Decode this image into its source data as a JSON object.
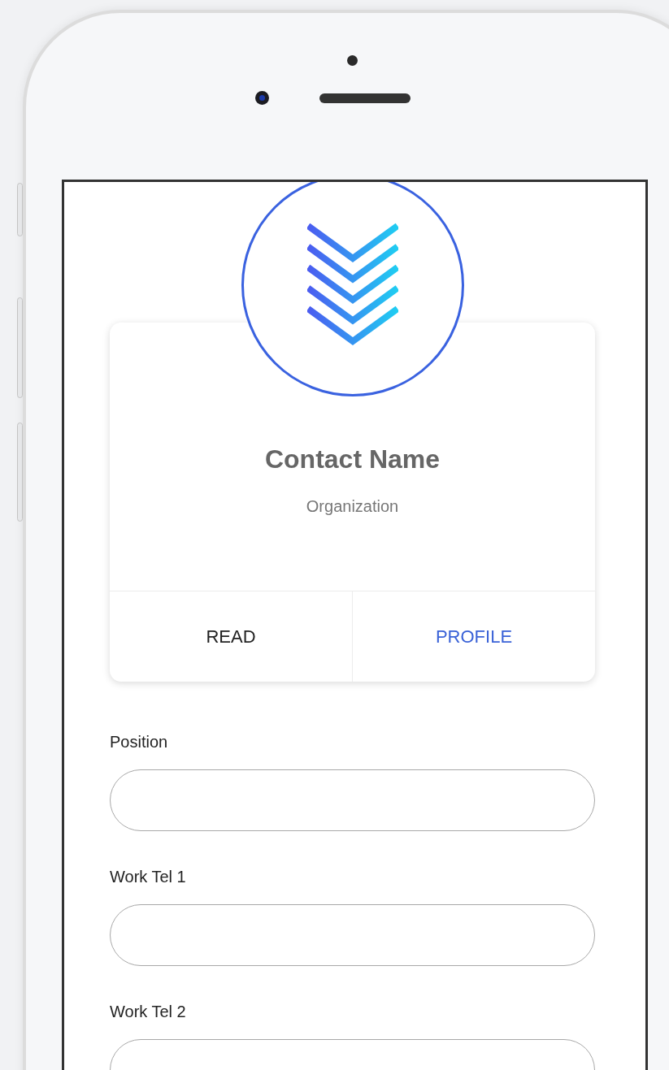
{
  "card": {
    "title": "Contact Name",
    "subtitle": "Organization",
    "actions": [
      {
        "label": "READ",
        "kind": "default"
      },
      {
        "label": "PROFILE",
        "kind": "primary"
      }
    ]
  },
  "form": {
    "fields": [
      {
        "label": "Position"
      },
      {
        "label": "Work Tel 1"
      },
      {
        "label": "Work Tel 2"
      }
    ]
  }
}
